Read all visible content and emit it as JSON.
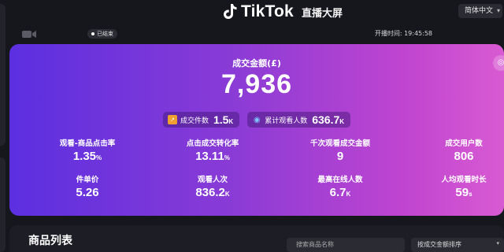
{
  "header": {
    "brand": "TikTok",
    "subtitle": "直播大屏",
    "language": "简体中文"
  },
  "status": {
    "live_badge": "已结束",
    "start_time": "开播时间: 19:45:58"
  },
  "gmv": {
    "label": "成交金额(£)",
    "value": "7,936"
  },
  "pills": [
    {
      "label": "成交件数",
      "value": "1.5",
      "unit": "K",
      "icon": "chart-icon"
    },
    {
      "label": "累计观看人数",
      "value": "636.7",
      "unit": "K",
      "icon": "eye-icon"
    }
  ],
  "metrics_row1": [
    {
      "label": "观看-商品点击率",
      "value": "1.35",
      "unit": "%"
    },
    {
      "label": "点击成交转化率",
      "value": "13.11",
      "unit": "%"
    },
    {
      "label": "千次观看成交金额",
      "value": "9",
      "unit": ""
    },
    {
      "label": "成交用户数",
      "value": "806",
      "unit": ""
    }
  ],
  "metrics_row2": [
    {
      "label": "件单价",
      "value": "5.26",
      "unit": ""
    },
    {
      "label": "观看人次",
      "value": "836.2",
      "unit": "K"
    },
    {
      "label": "最高在线人数",
      "value": "6.7",
      "unit": "K"
    },
    {
      "label": "人均观看时长",
      "value": "59",
      "unit": "s"
    }
  ],
  "products": {
    "title": "商品列表",
    "search_placeholder": "搜索商品名称",
    "sort_label": "按成交金额排序"
  },
  "colors": {
    "background": "#16171d",
    "card_gradient_start": "#5b2fe0",
    "card_gradient_end": "#d85ad2"
  }
}
